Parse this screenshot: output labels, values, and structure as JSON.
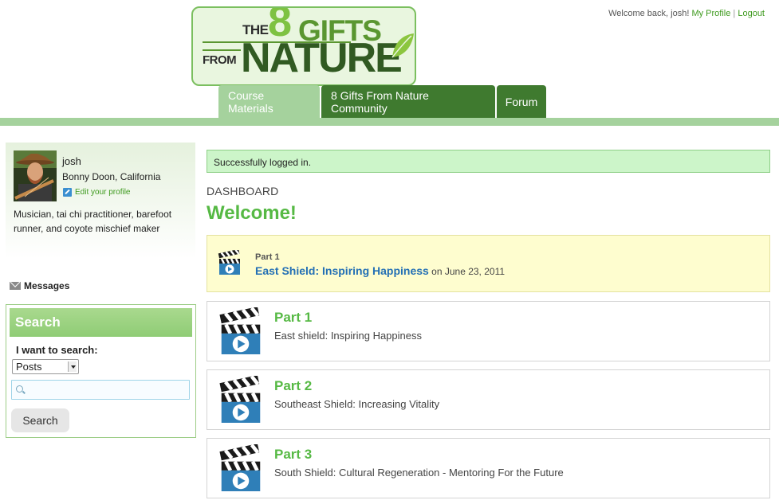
{
  "logo": {
    "the": "THE",
    "eight": "8",
    "gifts": "GIFTS",
    "from": "FROM",
    "nature": "NATURE"
  },
  "userlinks": {
    "welcome": "Welcome back, josh!",
    "profile": "My Profile",
    "separator": "|",
    "logout": "Logout"
  },
  "nav": {
    "tabs": [
      {
        "label": "Course Materials",
        "active": true
      },
      {
        "label": "8 Gifts From Nature Community",
        "active": false
      },
      {
        "label": "Forum",
        "active": false
      }
    ]
  },
  "profile": {
    "name": "josh",
    "location": "Bonny Doon, California",
    "edit": "Edit your profile",
    "bio": "Musician, tai chi practitioner, barefoot runner, and coyote mischief maker"
  },
  "messages_label": "Messages",
  "search": {
    "heading": "Search",
    "label": "I want to search:",
    "selected_option": "Posts",
    "button": "Search",
    "input_value": ""
  },
  "main": {
    "flash": "Successfully logged in.",
    "section": "DASHBOARD",
    "welcome": "Welcome!",
    "featured": {
      "part": "Part 1",
      "title": "East Shield: Inspiring Happiness",
      "date_text": " on June 23, 2011"
    },
    "items": [
      {
        "title": "Part 1",
        "desc": "East shield: Inspiring Happiness"
      },
      {
        "title": "Part 2",
        "desc": "Southeast Shield: Increasing Vitality"
      },
      {
        "title": "Part 3",
        "desc": "South Shield: Cultural Regeneration - Mentoring For the Future"
      }
    ]
  },
  "colors": {
    "brand_green": "#56b944",
    "tab_dark": "#3f7a2f",
    "tab_active": "#a5d29d",
    "link_blue": "#2470b5",
    "featured_bg": "#fefdcf",
    "flash_bg": "#ccf5c9"
  },
  "icons": {
    "video": "clapperboard-play-icon",
    "messages": "envelope-icon",
    "search": "magnifier-icon",
    "edit": "pencil-icon"
  }
}
